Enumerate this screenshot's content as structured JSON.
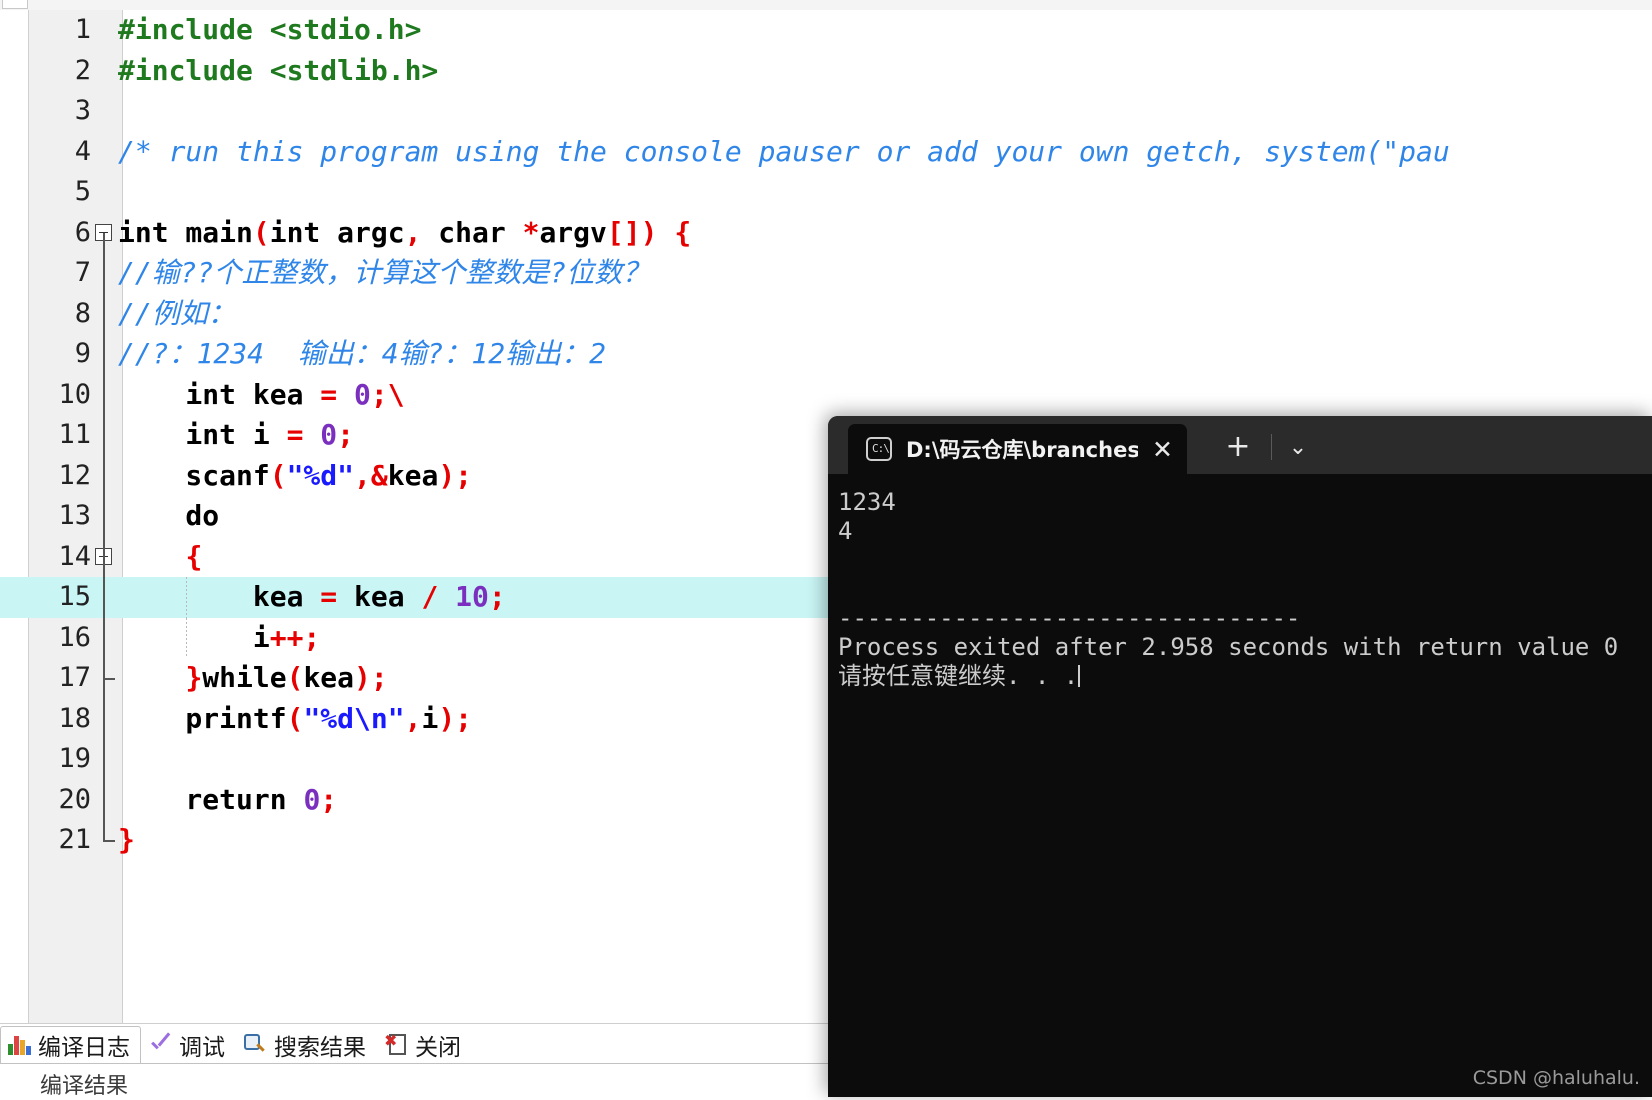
{
  "editor": {
    "lines": [
      {
        "n": "1",
        "fold": false,
        "segments": [
          {
            "t": "#include <stdio.h>",
            "c": "pp"
          }
        ]
      },
      {
        "n": "2",
        "fold": false,
        "segments": [
          {
            "t": "#include <stdlib.h>",
            "c": "pp"
          }
        ]
      },
      {
        "n": "3",
        "fold": false,
        "segments": []
      },
      {
        "n": "4",
        "fold": false,
        "segments": [
          {
            "t": "/* run this program using the console pauser or add your own getch, system(\"pau",
            "c": "cm"
          }
        ]
      },
      {
        "n": "5",
        "fold": false,
        "segments": []
      },
      {
        "n": "6",
        "fold": true,
        "segments": [
          {
            "t": "int main",
            "c": "pln"
          },
          {
            "t": "(",
            "c": "pun"
          },
          {
            "t": "int argc",
            "c": "pln"
          },
          {
            "t": ",",
            "c": "pun"
          },
          {
            "t": " char ",
            "c": "pln"
          },
          {
            "t": "*",
            "c": "pun"
          },
          {
            "t": "argv",
            "c": "pln"
          },
          {
            "t": "[]",
            "c": "pun"
          },
          {
            "t": ")",
            "c": "pun"
          },
          {
            "t": " ",
            "c": "pln"
          },
          {
            "t": "{",
            "c": "pun"
          }
        ]
      },
      {
        "n": "7",
        "fold": false,
        "segments": [
          {
            "t": "//输??个正整数，计算这个整数是?位数？",
            "c": "cm"
          }
        ]
      },
      {
        "n": "8",
        "fold": false,
        "segments": [
          {
            "t": "//例如：",
            "c": "cm"
          }
        ]
      },
      {
        "n": "9",
        "fold": false,
        "segments": [
          {
            "t": "//?：1234  输出：4输?：12输出：2",
            "c": "cm"
          }
        ]
      },
      {
        "n": "10",
        "fold": false,
        "segments": [
          {
            "t": "    int kea ",
            "c": "pln"
          },
          {
            "t": "=",
            "c": "pun"
          },
          {
            "t": " ",
            "c": "pln"
          },
          {
            "t": "0",
            "c": "num"
          },
          {
            "t": ";\\",
            "c": "pun"
          }
        ]
      },
      {
        "n": "11",
        "fold": false,
        "segments": [
          {
            "t": "    int i ",
            "c": "pln"
          },
          {
            "t": "=",
            "c": "pun"
          },
          {
            "t": " ",
            "c": "pln"
          },
          {
            "t": "0",
            "c": "num"
          },
          {
            "t": ";",
            "c": "pun"
          }
        ]
      },
      {
        "n": "12",
        "fold": false,
        "segments": [
          {
            "t": "    scanf",
            "c": "pln"
          },
          {
            "t": "(",
            "c": "pun"
          },
          {
            "t": "\"%d\"",
            "c": "str"
          },
          {
            "t": ",",
            "c": "pun"
          },
          {
            "t": "&",
            "c": "pun"
          },
          {
            "t": "kea",
            "c": "pln"
          },
          {
            "t": ")",
            "c": "pun"
          },
          {
            "t": ";",
            "c": "pun"
          }
        ]
      },
      {
        "n": "13",
        "fold": false,
        "segments": [
          {
            "t": "    do",
            "c": "pln"
          }
        ]
      },
      {
        "n": "14",
        "fold": true,
        "segments": [
          {
            "t": "    ",
            "c": "pln"
          },
          {
            "t": "{",
            "c": "pun"
          }
        ]
      },
      {
        "n": "15",
        "fold": false,
        "highlight": true,
        "segments": [
          {
            "t": "        kea ",
            "c": "pln"
          },
          {
            "t": "=",
            "c": "pun"
          },
          {
            "t": " kea ",
            "c": "pln"
          },
          {
            "t": "/",
            "c": "pun"
          },
          {
            "t": " ",
            "c": "pln"
          },
          {
            "t": "10",
            "c": "num"
          },
          {
            "t": ";",
            "c": "pun"
          }
        ]
      },
      {
        "n": "16",
        "fold": false,
        "segments": [
          {
            "t": "        i",
            "c": "pln"
          },
          {
            "t": "++;",
            "c": "pun"
          }
        ]
      },
      {
        "n": "17",
        "fold": false,
        "foldend": true,
        "segments": [
          {
            "t": "    ",
            "c": "pln"
          },
          {
            "t": "}",
            "c": "pun"
          },
          {
            "t": "while",
            "c": "pln"
          },
          {
            "t": "(",
            "c": "pun"
          },
          {
            "t": "kea",
            "c": "pln"
          },
          {
            "t": ")",
            "c": "pun"
          },
          {
            "t": ";",
            "c": "pun"
          }
        ]
      },
      {
        "n": "18",
        "fold": false,
        "segments": [
          {
            "t": "    printf",
            "c": "pln"
          },
          {
            "t": "(",
            "c": "pun"
          },
          {
            "t": "\"%d\\n\"",
            "c": "str"
          },
          {
            "t": ",",
            "c": "pun"
          },
          {
            "t": "i",
            "c": "pln"
          },
          {
            "t": ")",
            "c": "pun"
          },
          {
            "t": ";",
            "c": "pun"
          }
        ]
      },
      {
        "n": "19",
        "fold": false,
        "segments": []
      },
      {
        "n": "20",
        "fold": false,
        "segments": [
          {
            "t": "    return ",
            "c": "pln"
          },
          {
            "t": "0",
            "c": "num"
          },
          {
            "t": ";",
            "c": "pun"
          }
        ]
      },
      {
        "n": "21",
        "fold": false,
        "foldclose": true,
        "segments": [
          {
            "t": "}",
            "c": "pun"
          }
        ]
      }
    ],
    "highlight_color": "#c9f5f5"
  },
  "terminal": {
    "tab_title": "D:\\码云仓库\\branches-and-lo",
    "tab_icon": "cmd-prompt-icon",
    "close_label": "✕",
    "new_tab_label": "+",
    "dropdown_label": "⌄",
    "lines": [
      "1234",
      "4",
      "",
      "",
      "--------------------------------",
      "Process exited after 2.958 seconds with return value 0",
      "请按任意键继续. . ."
    ],
    "background": "#0c0c0c",
    "foreground": "#cccccc"
  },
  "bottom_bar": {
    "tabs": [
      {
        "label": "编译日志",
        "icon": "chart-icon",
        "active": true
      },
      {
        "label": "调试",
        "icon": "check-icon",
        "active": false
      },
      {
        "label": "搜索结果",
        "icon": "magnifier-icon",
        "active": false
      },
      {
        "label": "关闭",
        "icon": "close-doc-icon",
        "active": false
      }
    ],
    "status_text": "编译结果"
  },
  "watermark": {
    "text": "CSDN @haluhalu."
  }
}
